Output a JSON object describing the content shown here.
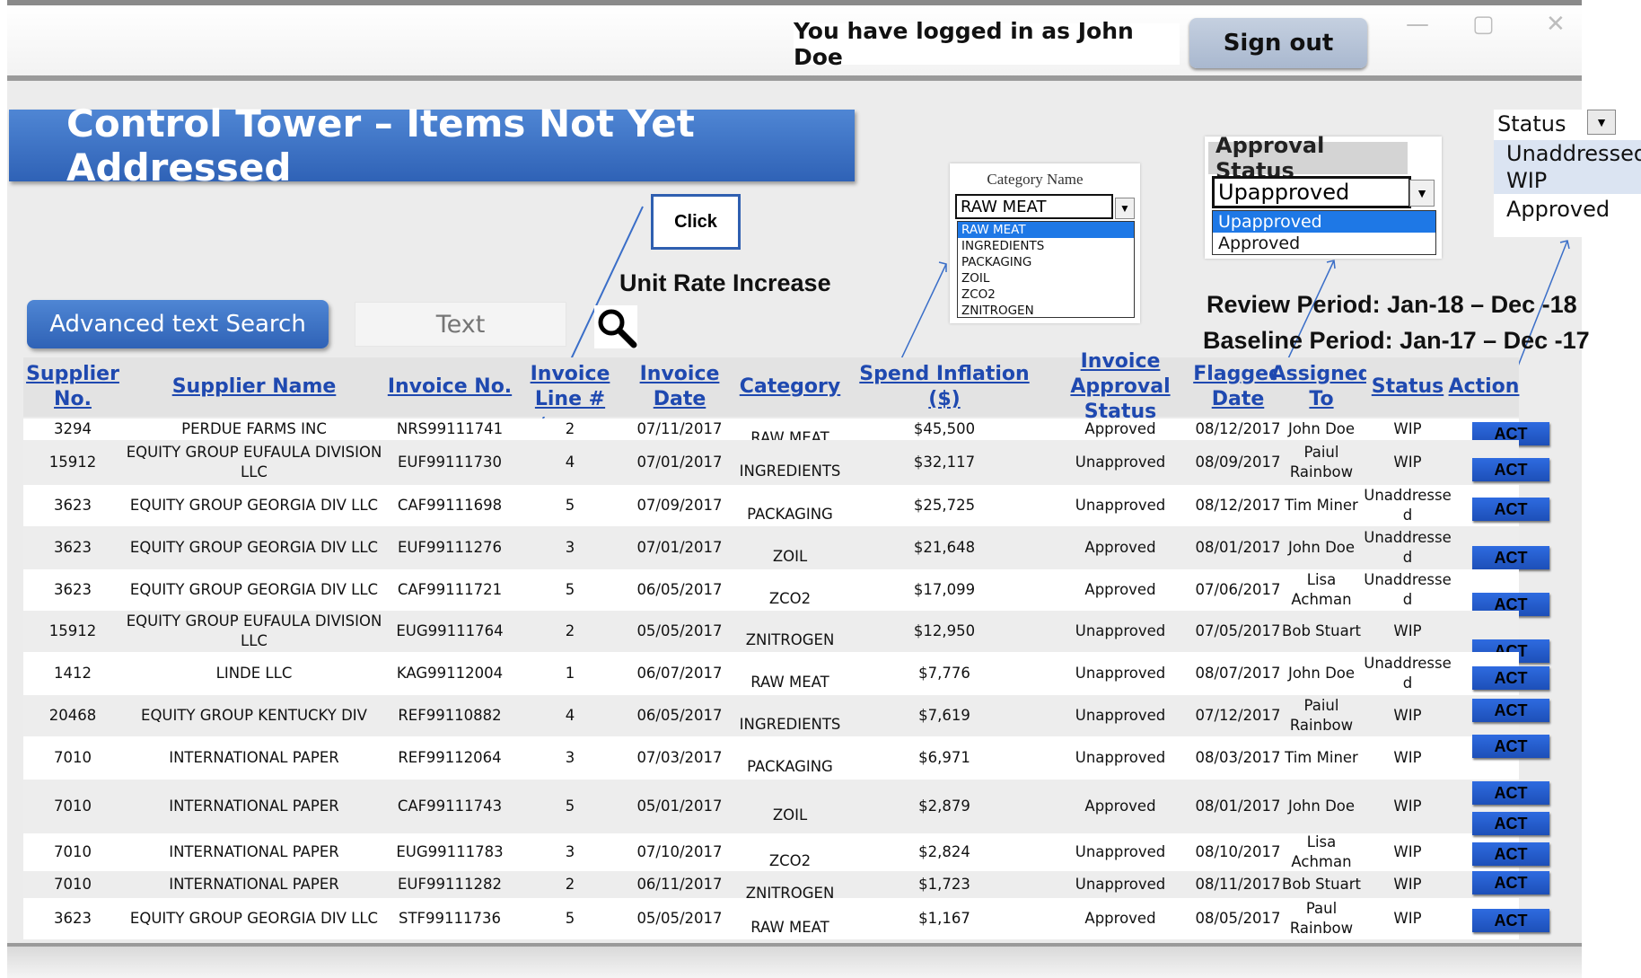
{
  "header": {
    "login_message": "You have logged in as John Doe",
    "sign_out_label": "Sign out",
    "window_controls": [
      "—",
      "▢",
      "✕"
    ]
  },
  "page_title": "Control Tower – Items Not Yet Addressed",
  "annotations": {
    "click_label": "Click",
    "unit_rate": "Unit Rate Increase",
    "review_period": "Review Period: Jan-18 – Dec -18",
    "baseline_period": "Baseline Period: Jan-17 – Dec -17"
  },
  "search": {
    "advanced_label": "Advanced text Search",
    "placeholder": "Text"
  },
  "category_filter": {
    "label": "Category Name",
    "selected": "RAW MEAT",
    "options": [
      "RAW MEAT",
      "INGREDIENTS",
      "PACKAGING",
      "ZOIL",
      "ZCO2",
      "ZNITROGEN"
    ]
  },
  "approval_filter": {
    "label": "Approval Status",
    "selected": "Upapproved",
    "options": [
      "Upapproved",
      "Approved"
    ]
  },
  "status_filter": {
    "label": "Status",
    "options": [
      "Unaddressed",
      "WIP",
      "Approved"
    ]
  },
  "table": {
    "columns": [
      "Supplier No.",
      "Supplier Name",
      "Invoice No.",
      "Invoice Line #",
      "Invoice Date",
      "Category",
      "Spend Inflation ($)",
      "Invoice Approval Status",
      "Flagged Date",
      "Assigned To",
      "Status",
      "Action"
    ],
    "action_label": "ACT",
    "rows": [
      {
        "supplier_no": "3294",
        "supplier_name": "PERDUE FARMS INC",
        "invoice_no": "NRS99111741",
        "line": "2",
        "date": "07/11/2017",
        "category": "RAW MEAT",
        "spend": "$45,500",
        "approval": "Approved",
        "flagged": "08/12/2017",
        "assigned": "John Doe",
        "status": "WIP"
      },
      {
        "supplier_no": "15912",
        "supplier_name": "EQUITY GROUP EUFAULA DIVISION LLC",
        "invoice_no": "EUF99111730",
        "line": "4",
        "date": "07/01/2017",
        "category": "INGREDIENTS",
        "spend": "$32,117",
        "approval": "Unapproved",
        "flagged": "08/09/2017",
        "assigned": "Paiul Rainbow",
        "status": "WIP"
      },
      {
        "supplier_no": "3623",
        "supplier_name": "EQUITY GROUP GEORGIA DIV LLC",
        "invoice_no": "CAF99111698",
        "line": "5",
        "date": "07/09/2017",
        "category": "PACKAGING",
        "spend": "$25,725",
        "approval": "Unapproved",
        "flagged": "08/12/2017",
        "assigned": "Tim Miner",
        "status": "Unaddresse d"
      },
      {
        "supplier_no": "3623",
        "supplier_name": "EQUITY GROUP GEORGIA DIV LLC",
        "invoice_no": "EUF99111276",
        "line": "3",
        "date": "07/01/2017",
        "category": "ZOIL",
        "spend": "$21,648",
        "approval": "Approved",
        "flagged": "08/01/2017",
        "assigned": "John Doe",
        "status": "Unaddresse d"
      },
      {
        "supplier_no": "3623",
        "supplier_name": "EQUITY GROUP GEORGIA DIV LLC",
        "invoice_no": "CAF99111721",
        "line": "5",
        "date": "06/05/2017",
        "category": "ZCO2",
        "spend": "$17,099",
        "approval": "Approved",
        "flagged": "07/06/2017",
        "assigned": "Lisa Achman",
        "status": "Unaddresse d"
      },
      {
        "supplier_no": "15912",
        "supplier_name": "EQUITY GROUP EUFAULA DIVISION LLC",
        "invoice_no": "EUG99111764",
        "line": "2",
        "date": "05/05/2017",
        "category": "ZNITROGEN",
        "spend": "$12,950",
        "approval": "Unapproved",
        "flagged": "07/05/2017",
        "assigned": "Bob Stuart",
        "status": "WIP"
      },
      {
        "supplier_no": "1412",
        "supplier_name": "LINDE LLC",
        "invoice_no": "KAG99112004",
        "line": "1",
        "date": "06/07/2017",
        "category": "RAW MEAT",
        "spend": "$7,776",
        "approval": "Unapproved",
        "flagged": "08/07/2017",
        "assigned": "John Doe",
        "status": "Unaddresse d"
      },
      {
        "supplier_no": "20468",
        "supplier_name": "EQUITY GROUP KENTUCKY DIV",
        "invoice_no": "REF99110882",
        "line": "4",
        "date": "06/05/2017",
        "category": "INGREDIENTS",
        "spend": "$7,619",
        "approval": "Unapproved",
        "flagged": "07/12/2017",
        "assigned": "Paiul Rainbow",
        "status": "WIP"
      },
      {
        "supplier_no": "7010",
        "supplier_name": "INTERNATIONAL PAPER",
        "invoice_no": "REF99112064",
        "line": "3",
        "date": "07/03/2017",
        "category": "PACKAGING",
        "spend": "$6,971",
        "approval": "Unapproved",
        "flagged": "08/03/2017",
        "assigned": "Tim Miner",
        "status": "WIP"
      },
      {
        "supplier_no": "7010",
        "supplier_name": "INTERNATIONAL PAPER",
        "invoice_no": "CAF99111743",
        "line": "5",
        "date": "05/01/2017",
        "category": "ZOIL",
        "spend": "$2,879",
        "approval": "Approved",
        "flagged": "08/01/2017",
        "assigned": "John Doe",
        "status": "WIP"
      },
      {
        "supplier_no": "7010",
        "supplier_name": "INTERNATIONAL PAPER",
        "invoice_no": "EUG99111783",
        "line": "3",
        "date": "07/10/2017",
        "category": "ZCO2",
        "spend": "$2,824",
        "approval": "Unapproved",
        "flagged": "08/10/2017",
        "assigned": "Lisa Achman",
        "status": "WIP"
      },
      {
        "supplier_no": "7010",
        "supplier_name": "INTERNATIONAL PAPER",
        "invoice_no": "EUF99111282",
        "line": "2",
        "date": "06/11/2017",
        "category": "ZNITROGEN",
        "spend": "$1,723",
        "approval": "Unapproved",
        "flagged": "08/11/2017",
        "assigned": "Bob Stuart",
        "status": "WIP"
      },
      {
        "supplier_no": "3623",
        "supplier_name": "EQUITY GROUP GEORGIA DIV LLC",
        "invoice_no": "STF99111736",
        "line": "5",
        "date": "05/05/2017",
        "category": "RAW MEAT",
        "spend": "$1,167",
        "approval": "Approved",
        "flagged": "08/05/2017",
        "assigned": "Paul Rainbow",
        "status": "WIP"
      }
    ]
  },
  "colors": {
    "accent_blue": "#2f62b6",
    "header_link": "#1f49b0",
    "act_button": "#2e6be0",
    "selection": "#1e78e6"
  }
}
